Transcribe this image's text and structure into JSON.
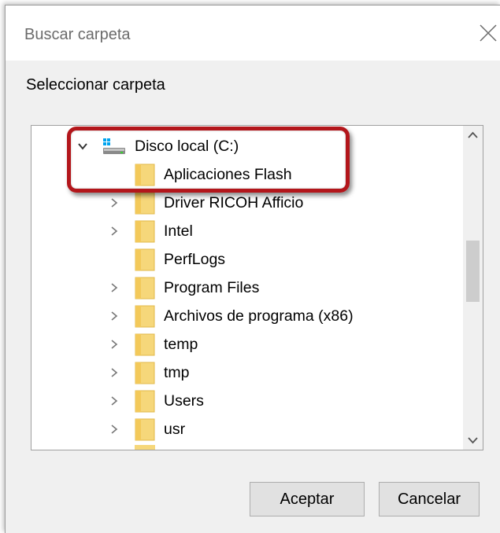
{
  "dialog": {
    "title": "Buscar carpeta",
    "prompt": "Seleccionar carpeta",
    "tree": {
      "root": {
        "label": "Disco local (C:)",
        "icon": "drive-icon",
        "expanded": true
      },
      "items": [
        {
          "label": "Aplicaciones Flash",
          "expandable": false
        },
        {
          "label": "Driver RICOH Afficio",
          "expandable": true
        },
        {
          "label": "Intel",
          "expandable": true
        },
        {
          "label": "PerfLogs",
          "expandable": false
        },
        {
          "label": "Program Files",
          "expandable": true
        },
        {
          "label": "Archivos de programa (x86)",
          "expandable": true
        },
        {
          "label": "temp",
          "expandable": true
        },
        {
          "label": "tmp",
          "expandable": true
        },
        {
          "label": "Users",
          "expandable": true
        },
        {
          "label": "usr",
          "expandable": true
        }
      ]
    },
    "buttons": {
      "ok_label": "Aceptar",
      "cancel_label": "Cancelar"
    }
  },
  "colors": {
    "highlight": "#b3161b",
    "folder": "#f6d77a",
    "dialog_bg": "#f0f0f0"
  }
}
